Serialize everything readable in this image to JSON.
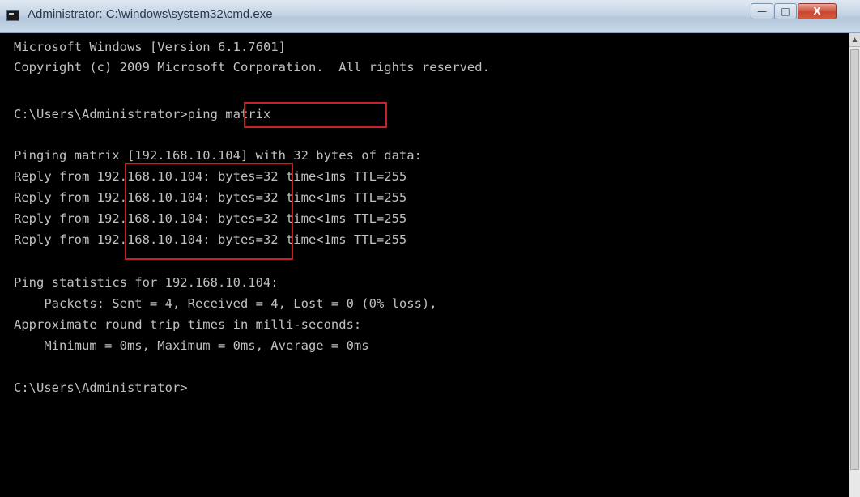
{
  "window": {
    "title": "Administrator: C:\\windows\\system32\\cmd.exe",
    "icon": "cmd-icon",
    "controls": {
      "minimize": "—",
      "maximize": "□",
      "close": "X"
    }
  },
  "console": {
    "lines": [
      "Microsoft Windows [Version 6.1.7601]",
      "Copyright (c) 2009 Microsoft Corporation.  All rights reserved.",
      "",
      "C:\\Users\\Administrator>ping matrix",
      "",
      "Pinging matrix [192.168.10.104] with 32 bytes of data:",
      "Reply from 192.168.10.104: bytes=32 time<1ms TTL=255",
      "Reply from 192.168.10.104: bytes=32 time<1ms TTL=255",
      "Reply from 192.168.10.104: bytes=32 time<1ms TTL=255",
      "Reply from 192.168.10.104: bytes=32 time<1ms TTL=255",
      "",
      "Ping statistics for 192.168.10.104:",
      "    Packets: Sent = 4, Received = 4, Lost = 0 (0% loss),",
      "Approximate round trip times in milli-seconds:",
      "    Minimum = 0ms, Maximum = 0ms, Average = 0ms",
      "",
      "C:\\Users\\Administrator>"
    ]
  },
  "highlights": {
    "command": "ping matrix",
    "reply_ips": "192.168.10.104"
  },
  "colors": {
    "console_bg": "#000000",
    "console_text": "#c0c0c0",
    "highlight_border": "#c8202a"
  }
}
